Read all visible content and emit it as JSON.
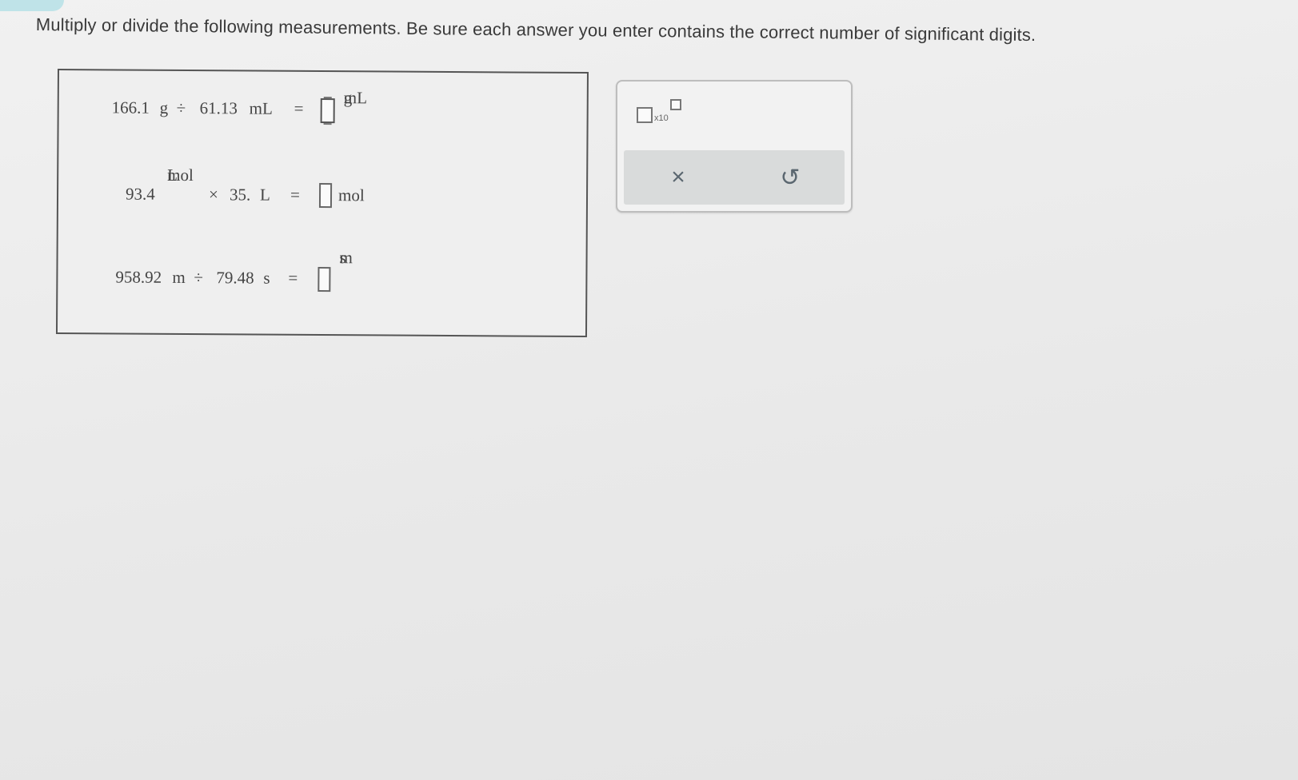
{
  "instruction": "Multiply or divide the following measurements. Be sure each answer you enter contains the correct number of significant digits.",
  "problems": [
    {
      "left_value1": "166.1",
      "left_unit1": "g",
      "operator": "÷",
      "left_value2": "61.13",
      "left_unit2": "mL",
      "equals": "=",
      "answer_value": "",
      "answer_unit_num": "g",
      "answer_unit_den": "mL"
    },
    {
      "left_value1": "93.4",
      "left_unit_num": "mol",
      "left_unit_den": "L",
      "operator": "×",
      "left_value2": "35.",
      "left_unit2": "L",
      "equals": "=",
      "answer_value": "",
      "answer_unit": "mol"
    },
    {
      "left_value1": "958.92",
      "left_unit1": "m",
      "operator": "÷",
      "left_value2": "79.48",
      "left_unit2": "s",
      "equals": "=",
      "answer_value": "",
      "answer_unit_num": "m",
      "answer_unit_den": "s"
    }
  ],
  "toolbar": {
    "sci_notation_label": "x10",
    "clear_symbol": "×",
    "undo_symbol": "↺"
  },
  "icons": {
    "sci_notation": "scientific-notation-icon",
    "clear": "close-icon",
    "undo": "undo-icon"
  },
  "colors": {
    "tab_accent": "#bfe3e8",
    "action_bar": "#d9dbdb",
    "icon": "#5b6770"
  }
}
